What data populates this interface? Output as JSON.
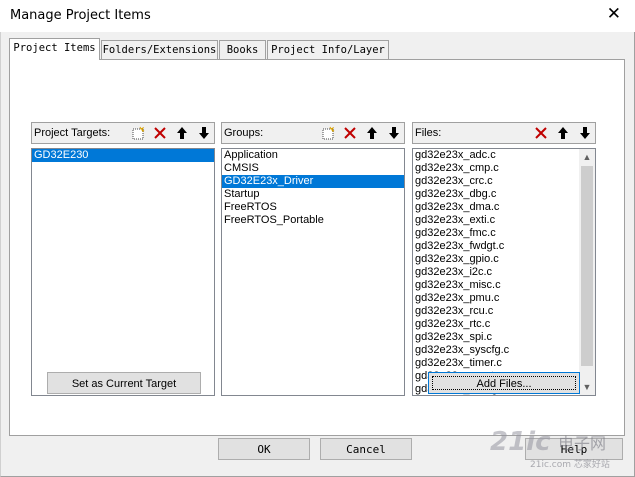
{
  "window": {
    "title": "Manage Project Items"
  },
  "tabs": [
    {
      "label": "Project Items"
    },
    {
      "label": "Folders/Extensions"
    },
    {
      "label": "Books"
    },
    {
      "label": "Project Info/Layer"
    }
  ],
  "targets": {
    "label": "Project Targets:",
    "items": [
      "GD32E230"
    ]
  },
  "groups": {
    "label": "Groups:",
    "items": [
      "Application",
      "CMSIS",
      "GD32E23x_Driver",
      "Startup",
      "FreeRTOS",
      "FreeRTOS_Portable"
    ]
  },
  "files": {
    "label": "Files:",
    "items": [
      "gd32e23x_adc.c",
      "gd32e23x_cmp.c",
      "gd32e23x_crc.c",
      "gd32e23x_dbg.c",
      "gd32e23x_dma.c",
      "gd32e23x_exti.c",
      "gd32e23x_fmc.c",
      "gd32e23x_fwdgt.c",
      "gd32e23x_gpio.c",
      "gd32e23x_i2c.c",
      "gd32e23x_misc.c",
      "gd32e23x_pmu.c",
      "gd32e23x_rcu.c",
      "gd32e23x_rtc.c",
      "gd32e23x_spi.c",
      "gd32e23x_syscfg.c",
      "gd32e23x_timer.c",
      "gd32e23x_usart.c",
      "gd32e23x_wwdgt.c"
    ]
  },
  "buttons": {
    "set_target": "Set as Current Target",
    "add_files": "Add Files...",
    "ok": "OK",
    "cancel": "Cancel",
    "help": "Help"
  },
  "watermark": {
    "logo": "21ic",
    "cn": "电子网",
    "sub": "21ic.com 芯家好站"
  },
  "colors": {
    "selection": "#0078d7",
    "delete_red": "#c00000",
    "dialog_bg": "#f0f0f0"
  }
}
